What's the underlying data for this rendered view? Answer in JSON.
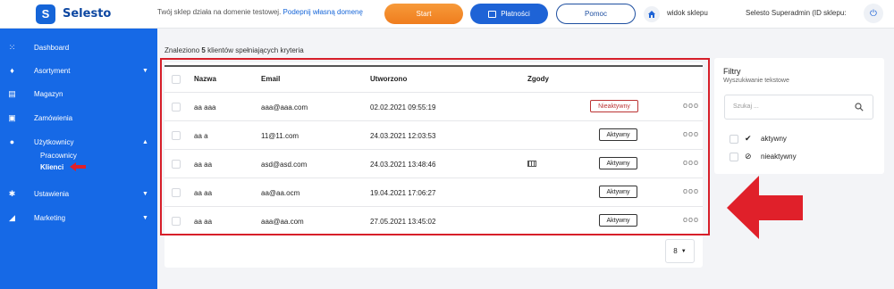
{
  "app": {
    "logo_letter": "S",
    "name": "Selesto"
  },
  "topbar": {
    "notice_text": "Twój sklep działa na domenie testowej.",
    "notice_link": "Podepnij własną domenę",
    "start_label": "Start",
    "payments_label": "Płatności",
    "help_label": "Pomoc",
    "view_shop_label": "widok sklepu",
    "user_label": "Selesto Superadmin (ID sklepu:"
  },
  "sidebar": {
    "items": [
      {
        "label": "Dashboard",
        "icon": "grid-icon"
      },
      {
        "label": "Asortyment",
        "icon": "tag-icon",
        "caret": "▼"
      },
      {
        "label": "Magazyn",
        "icon": "warehouse-icon"
      },
      {
        "label": "Zamówienia",
        "icon": "bag-icon"
      },
      {
        "label": "Użytkownicy",
        "icon": "user-icon",
        "caret": "▲"
      },
      {
        "label": "Ustawienia",
        "icon": "gear-icon",
        "caret": "▼"
      },
      {
        "label": "Marketing",
        "icon": "megaphone-icon",
        "caret": "▼"
      }
    ],
    "subitems": [
      {
        "label": "Pracownicy"
      },
      {
        "label": "Klienci"
      }
    ]
  },
  "main": {
    "found_prefix": "Znaleziono",
    "found_count": "5",
    "found_suffix": "klientów spełniających kryteria",
    "columns": {
      "name": "Nazwa",
      "email": "Email",
      "created": "Utworzono",
      "consents": "Zgody"
    },
    "rows": [
      {
        "name": "aa aaa",
        "email": "aaa@aaa.com",
        "created": "02.02.2021 09:55:19",
        "status": "Nieaktywny"
      },
      {
        "name": "aa a",
        "email": "11@11.com",
        "created": "24.03.2021 12:03:53",
        "status": "Aktywny"
      },
      {
        "name": "aa aa",
        "email": "asd@asd.com",
        "created": "24.03.2021 13:48:46",
        "status": "Aktywny"
      },
      {
        "name": "aa aa",
        "email": "aa@aa.ocm",
        "created": "19.04.2021 17:06:27",
        "status": "Aktywny"
      },
      {
        "name": "aa aa",
        "email": "aaa@aa.com",
        "created": "27.05.2021 13:45:02",
        "status": "Aktywny"
      }
    ],
    "row_menu": "ooo",
    "page_size": "8"
  },
  "filters": {
    "title": "Filtry",
    "subtitle": "Wyszukiwanie tekstowe",
    "search_placeholder": "Szukaj ...",
    "options": [
      {
        "label": "aktywny",
        "icon": "check-icon"
      },
      {
        "label": "nieaktywny",
        "icon": "ban-icon"
      }
    ]
  },
  "colors": {
    "sidebar": "#1669e6",
    "start": "#f28a2b",
    "pay": "#1e63d6",
    "highlight": "#d71f2a"
  }
}
